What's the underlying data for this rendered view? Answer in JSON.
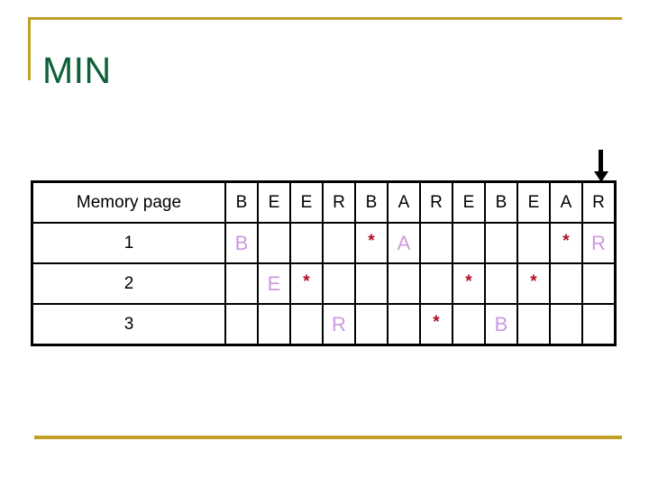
{
  "slide": {
    "title": "MIN",
    "title_color": "#0d6135",
    "accent_color": "#bfa024",
    "letter_color": "#cc99dd",
    "star_color": "#b01020"
  },
  "pointer": {
    "icon": "down-arrow-icon",
    "target_column_index": 11,
    "target_reference": "R"
  },
  "table": {
    "row_label_header": "Memory page",
    "reference_string": [
      "B",
      "E",
      "E",
      "R",
      "B",
      "A",
      "R",
      "E",
      "B",
      "E",
      "A",
      "R"
    ],
    "frames": [
      {
        "label": "1",
        "cells": [
          "B",
          "",
          "",
          "",
          "*",
          "A",
          "",
          "",
          "",
          "",
          "*",
          "R"
        ]
      },
      {
        "label": "2",
        "cells": [
          "",
          "E",
          "*",
          "",
          "",
          "",
          "",
          "*",
          "",
          "*",
          "",
          ""
        ]
      },
      {
        "label": "3",
        "cells": [
          "",
          "",
          "",
          "R",
          "",
          "",
          "*",
          "",
          "B",
          "",
          "",
          ""
        ]
      }
    ]
  }
}
